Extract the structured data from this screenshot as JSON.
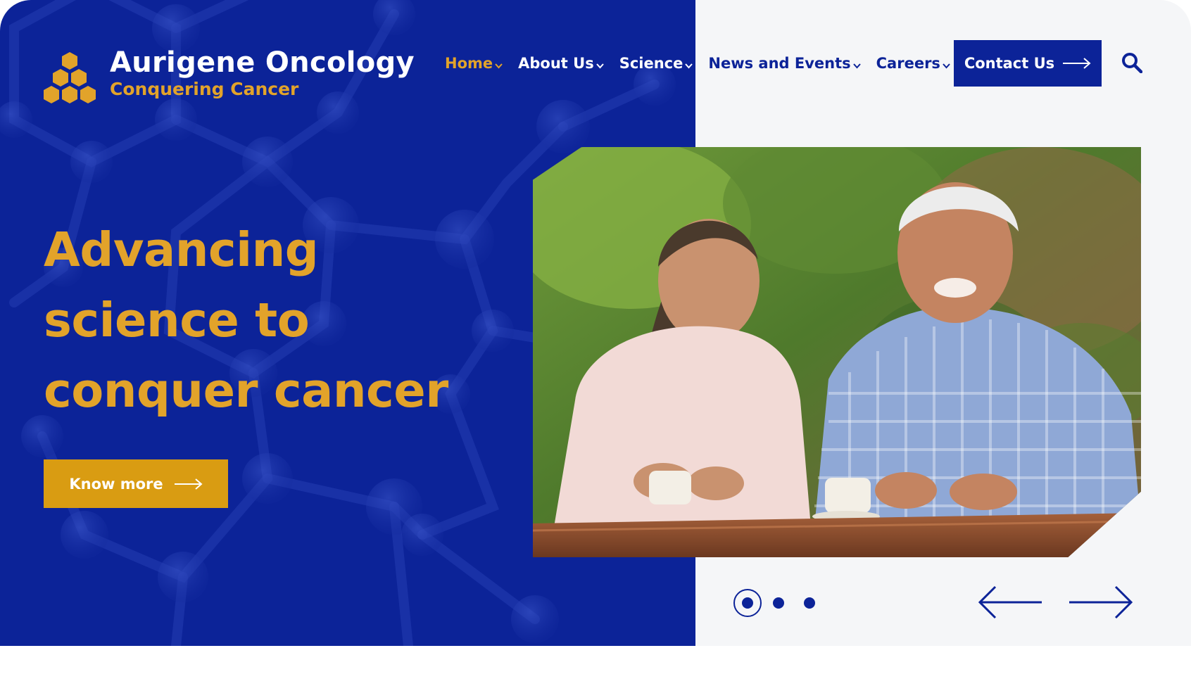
{
  "brand": {
    "name": "Aurigene Oncology",
    "tagline": "Conquering Cancer",
    "logo_icon": "honeycomb-logo-icon"
  },
  "nav": {
    "items": [
      {
        "label": "Home",
        "active": true
      },
      {
        "label": "About Us",
        "active": false
      },
      {
        "label": "Science",
        "active": false
      },
      {
        "label": "News and Events",
        "active": false
      },
      {
        "label": "Careers",
        "active": false
      }
    ],
    "contact_label": "Contact Us",
    "search_icon": "search-icon"
  },
  "hero": {
    "headline_line1": "Advancing",
    "headline_line2": "science to",
    "headline_line3": "conquer cancer",
    "cta_label": "Know more",
    "slide_count": 3,
    "active_slide": 1
  },
  "colors": {
    "brand_blue": "#0c2398",
    "brand_gold": "#e2a32a",
    "cta_gold": "#d99c12",
    "panel_bg": "#f5f6f8"
  }
}
